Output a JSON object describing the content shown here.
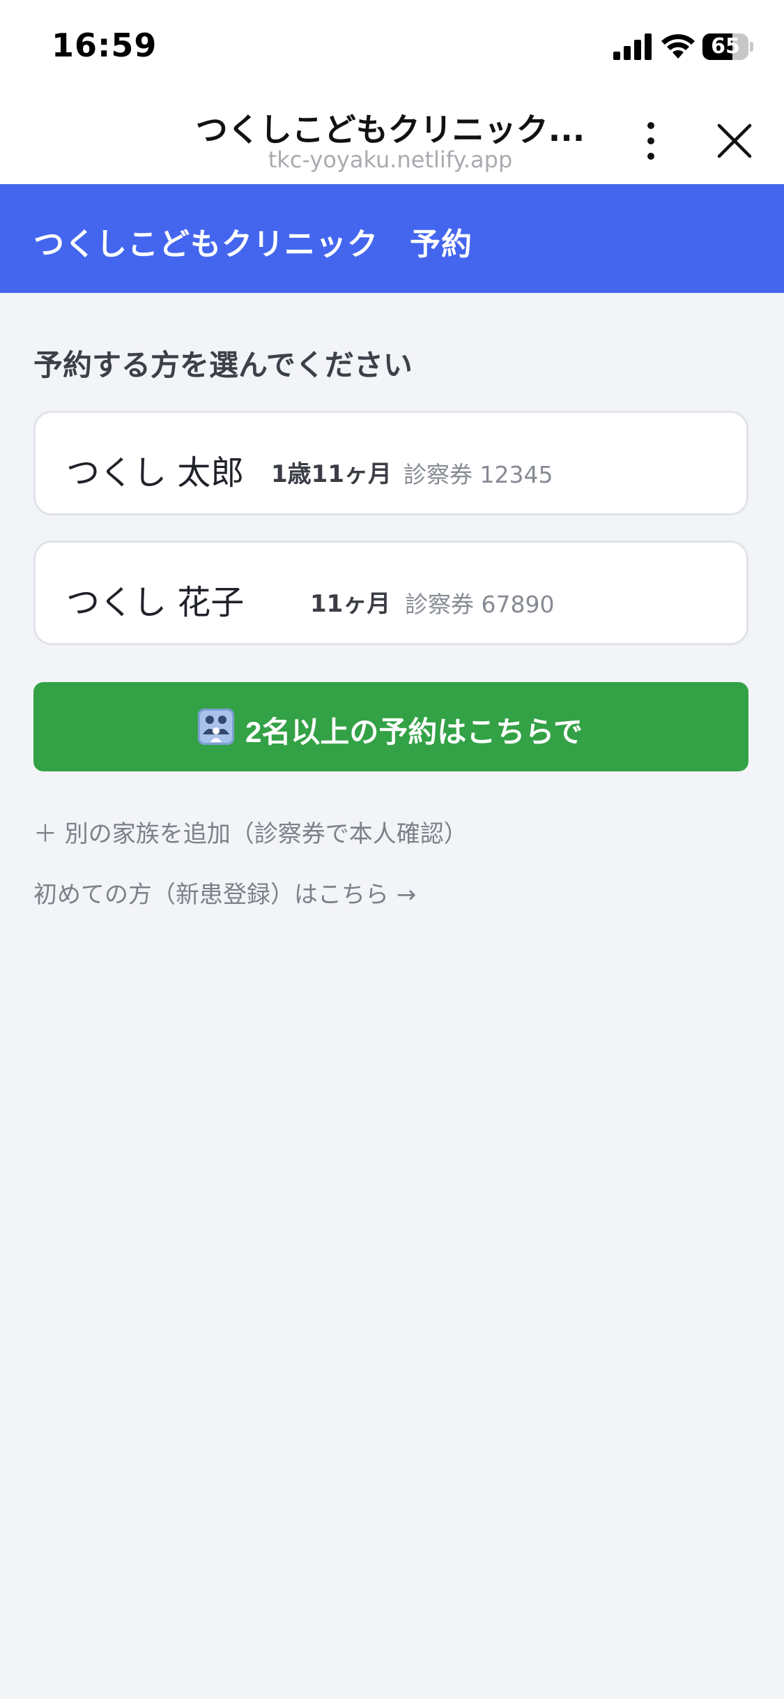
{
  "status_bar": {
    "time": "16:59",
    "battery": "65",
    "battery_level": 0.65
  },
  "browser": {
    "title": "つくしこどもクリニック...",
    "url": "tkc-yoyaku.netlify.app"
  },
  "app": {
    "title": "つくしこどもクリニック　予約",
    "accent_color": "#4466ee"
  },
  "main": {
    "heading": "予約する方を選んでください",
    "patients": [
      {
        "name": "つくし 太郎",
        "age": "1歳11ヶ月",
        "ticket": "診察券 12345"
      },
      {
        "name": "つくし 花子",
        "age": "11ヶ月",
        "ticket": "診察券 67890"
      }
    ],
    "multi_booking_label": "2名以上の予約はこちらで",
    "multi_booking_color": "#33a145",
    "add_family_label": "＋ 別の家族を追加（診察券で本人確認）",
    "new_patient_label": "初めての方（新患登録）はこちら →"
  }
}
